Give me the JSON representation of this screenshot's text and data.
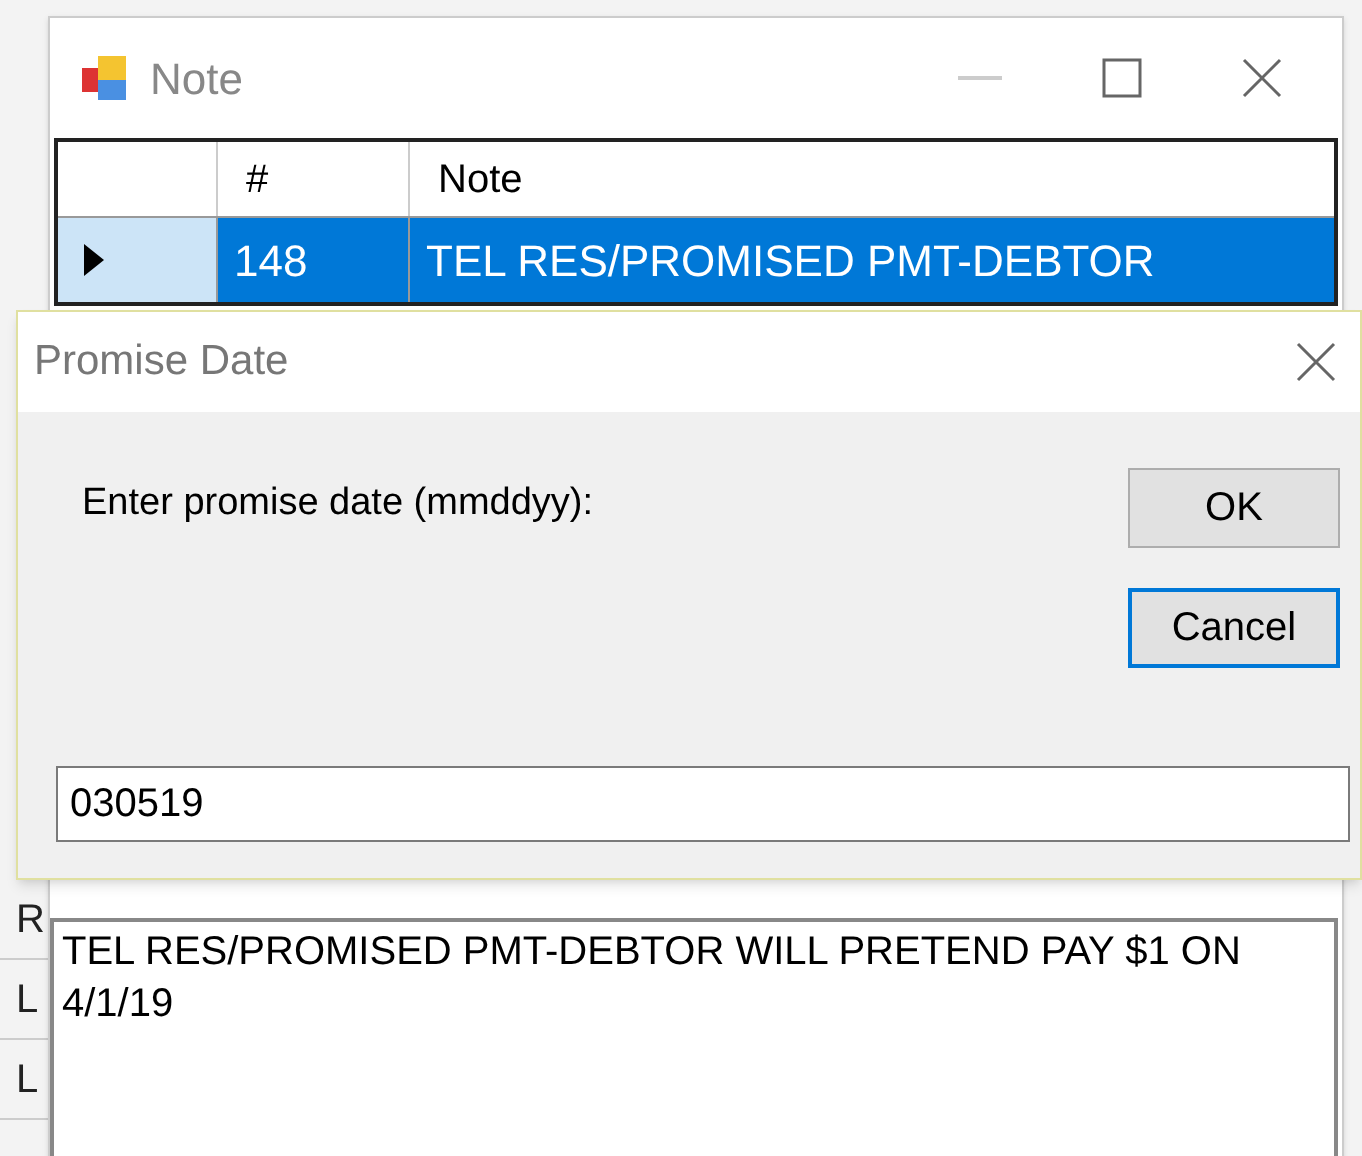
{
  "background_labels": [
    "R",
    "L",
    "L"
  ],
  "note_window": {
    "title": "Note",
    "grid": {
      "columns": [
        "#",
        "Note"
      ],
      "rows": [
        {
          "number": "148",
          "note": "TEL RES/PROMISED PMT-DEBTOR",
          "selected": true
        }
      ]
    },
    "note_text": "TEL RES/PROMISED PMT-DEBTOR WILL PRETEND PAY $1 ON 4/1/19"
  },
  "dialog": {
    "title": "Promise Date",
    "prompt": "Enter promise date (mmddyy):",
    "buttons": [
      {
        "label": "OK",
        "selected": false
      },
      {
        "label": "Cancel",
        "selected": true
      }
    ],
    "value": "030519"
  }
}
